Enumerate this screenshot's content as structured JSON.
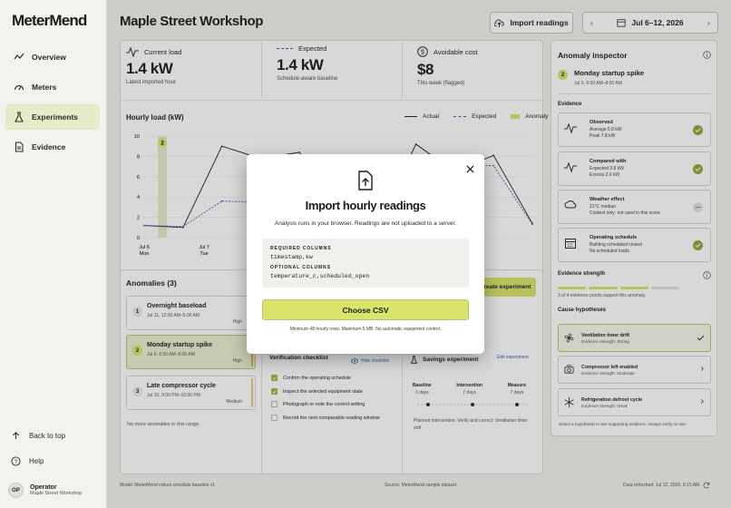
{
  "app": {
    "logo": "MeterMend"
  },
  "nav": [
    {
      "label": "Overview",
      "icon": "trend-icon"
    },
    {
      "label": "Meters",
      "icon": "gauge-icon"
    },
    {
      "label": "Experiments",
      "icon": "flask-icon",
      "active": true
    },
    {
      "label": "Evidence",
      "icon": "document-icon"
    }
  ],
  "sidebar_footer": {
    "back_to_top": "Back to top",
    "help": "Help",
    "user_initials": "OP",
    "user_name": "Operator",
    "user_site": "Maple Street Workshop"
  },
  "header": {
    "title": "Maple Street Workshop",
    "import_button": "Import readings",
    "date_range": "Jul 6–12, 2026"
  },
  "kpis": {
    "current_load": {
      "label": "Current load",
      "value": "1.4 kW",
      "sub": "Latest imported hour"
    },
    "expected": {
      "label": "Expected",
      "value": "1.4 kW",
      "sub": "Schedule-aware baseline"
    },
    "avoidable_cost": {
      "label": "Avoidable cost",
      "value": "$8",
      "sub": "This week (flagged)"
    }
  },
  "chart": {
    "title": "Hourly load (kW)",
    "legend": {
      "actual": "Actual",
      "expected": "Expected",
      "anomaly": "Anomaly"
    },
    "y_ticks": [
      "10",
      "8",
      "6",
      "4",
      "2",
      "0"
    ],
    "x_ticks": [
      {
        "d": "Jul 6",
        "w": "Mon"
      },
      {
        "d": "Jul 7",
        "w": "Tue"
      }
    ],
    "marker": "2"
  },
  "chart_data": {
    "type": "line",
    "title": "Hourly load (kW)",
    "ylim": [
      0,
      10
    ],
    "x": [
      "Jul 6 Mon",
      "Jul 7 Tue"
    ],
    "series": [
      {
        "name": "Actual",
        "values": [
          1.2,
          1.0,
          9.0,
          7.8,
          8.4,
          2.0,
          1.1,
          9.2,
          6.5,
          8.1,
          1.4
        ]
      },
      {
        "name": "Expected",
        "values": [
          1.2,
          1.1,
          3.6,
          3.5,
          3.4,
          1.8,
          1.2,
          7.3,
          7.0,
          7.1,
          1.3
        ]
      }
    ],
    "anomaly_window": "Jul 6, 6:00 AM–8:00 AM"
  },
  "anomalies": {
    "title": "Anomalies (3)",
    "items": [
      {
        "num": "1",
        "title": "Overnight baseload",
        "time": "Jul 11, 12:00 AM–5:00 AM",
        "severity": "High"
      },
      {
        "num": "2",
        "title": "Monday startup spike",
        "time": "Jul 6, 6:00 AM–8:00 AM",
        "severity": "High",
        "selected": true
      },
      {
        "num": "3",
        "title": "Late compressor cycle",
        "time": "Jul 10, 9:00 PM–10:00 PM",
        "severity": "Medium"
      }
    ],
    "footer": "No more anomalies in this range."
  },
  "create_experiment_button": "Create experiment",
  "verification": {
    "title": "Verification checklist",
    "hide": "Hide checklist",
    "items": [
      {
        "label": "Confirm the operating schedule",
        "checked": true
      },
      {
        "label": "Inspect the selected equipment state",
        "checked": true
      },
      {
        "label": "Photograph or note the control setting",
        "checked": false
      },
      {
        "label": "Record the next comparable reading window",
        "checked": false
      }
    ]
  },
  "savings": {
    "title": "Savings experiment",
    "edit": "Edit experiment",
    "phases": [
      {
        "name": "Baseline",
        "days": "3 days"
      },
      {
        "name": "Intervention",
        "days": "7 days"
      },
      {
        "name": "Measure",
        "days": "7 days"
      }
    ],
    "planned": "Planned intervention: Verify and correct: Ventilation timer drift"
  },
  "inspector": {
    "title": "Anomaly inspector",
    "badge": "2",
    "anomaly_title": "Monday startup spike",
    "anomaly_time": "Jul 6, 6:00 AM–8:00 AM",
    "evidence_title": "Evidence",
    "evidence": [
      {
        "title": "Observed",
        "lines": [
          "Average 5.8 kW",
          "Peak 7.8 kW"
        ],
        "icon": "pulse-icon",
        "ok": true
      },
      {
        "title": "Compared with",
        "lines": [
          "Expected 3.8 kW",
          "Excess 2.0 kW"
        ],
        "icon": "pulse-icon",
        "ok": true
      },
      {
        "title": "Weather effect",
        "lines": [
          "21°C median",
          "Context only: not used in this score"
        ],
        "icon": "cloud-icon",
        "ok": false
      },
      {
        "title": "Operating schedule",
        "lines": [
          "Building scheduled closed",
          "No scheduled loads"
        ],
        "icon": "calendar-icon",
        "ok": true
      }
    ],
    "strength_title": "Evidence strength",
    "strength_filled": 3,
    "strength_total": 4,
    "strength_text": "3 of 4 evidence points support this anomaly.",
    "cause_title": "Cause hypotheses",
    "causes": [
      {
        "title": "Ventilation timer drift",
        "strength": "Evidence strength: Strong",
        "icon": "fan-icon"
      },
      {
        "title": "Compressor left enabled",
        "strength": "Evidence strength: Moderate",
        "icon": "compressor-icon"
      },
      {
        "title": "Refrigeration defrost cycle",
        "strength": "Evidence strength: Weak",
        "icon": "snowflake-icon"
      }
    ],
    "cause_hint": "Select a hypothesis to see supporting evidence. Always verify on site."
  },
  "footer": {
    "model": "Model: MeterMend robust schedule baseline v1",
    "source": "Source: MeterMend sample dataset",
    "refreshed": "Data refreshed: Jul 12, 2026, 9:15 AM"
  },
  "modal": {
    "title": "Import hourly readings",
    "subtitle": "Analysis runs in your browser. Readings are not uploaded to a server.",
    "required_label": "REQUIRED COLUMNS",
    "required_cols": "timestamp,kw",
    "optional_label": "OPTIONAL COLUMNS",
    "optional_cols": "temperature_c,scheduled_open",
    "button": "Choose CSV",
    "note": "Minimum 48 hourly rows. Maximum 5 MB. No automatic equipment control."
  },
  "colors": {
    "accent": "#d8e46a",
    "accent_dark": "#97a338",
    "anomaly_fill": "#e5ecca",
    "amber": "#e0a53c"
  }
}
